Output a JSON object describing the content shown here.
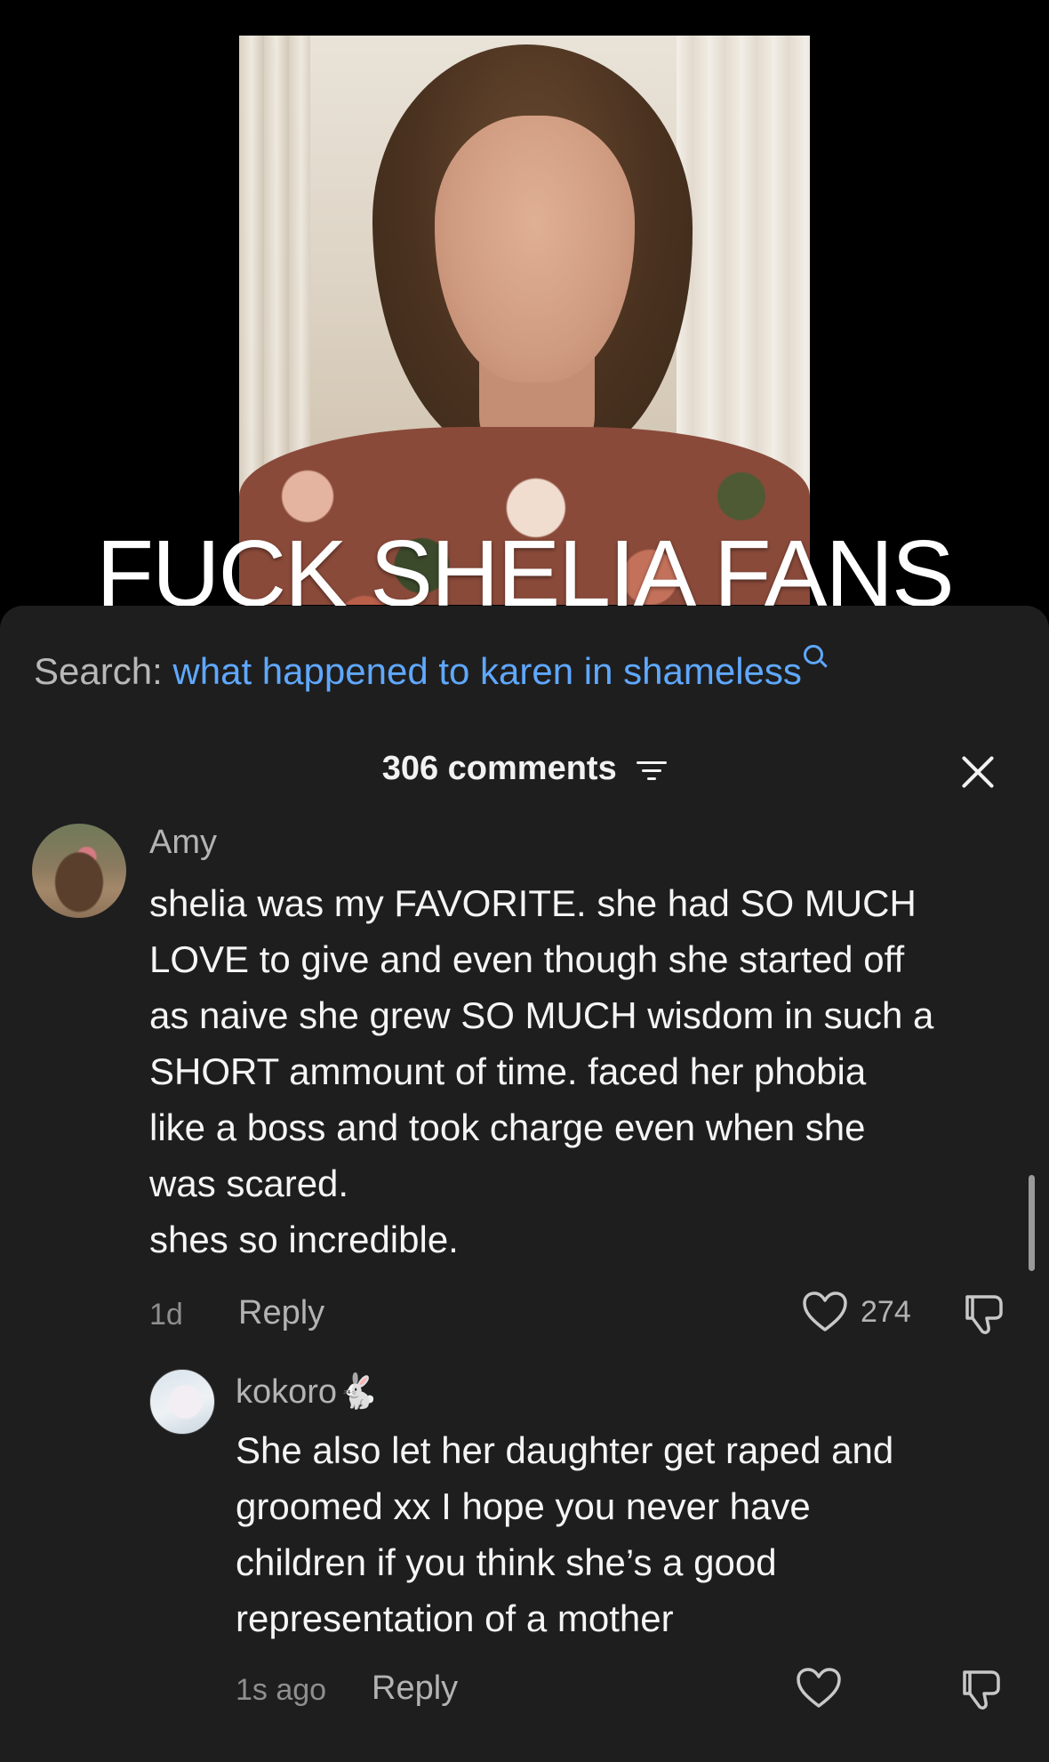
{
  "video": {
    "overlay_title": "FUCK SHELIA FANS"
  },
  "search": {
    "label": "Search:",
    "query": "what happened to karen in shameless"
  },
  "comments_header": {
    "count_label": "306 comments"
  },
  "comments": [
    {
      "username": "Amy",
      "text": "shelia was my FAVORITE. she had SO MUCH\nLOVE to give and even though she started off\nas naive she grew SO MUCH wisdom in such a\nSHORT ammount of time. faced her phobia\nlike a boss and took charge even when she\nwas scared.\nshes so incredible.",
      "time": "1d",
      "reply_label": "Reply",
      "likes": "274"
    },
    {
      "username": "kokoro🐇",
      "text": "She also let her daughter get raped and\ngroomed xx I hope you never have\nchildren if you think she’s a good\nrepresentation of a mother",
      "time": "1s ago",
      "reply_label": "Reply"
    }
  ],
  "colors": {
    "sheet_bg": "#1e1e1e",
    "link_blue": "#5fa8ff",
    "muted_text": "#b3b3b3"
  }
}
